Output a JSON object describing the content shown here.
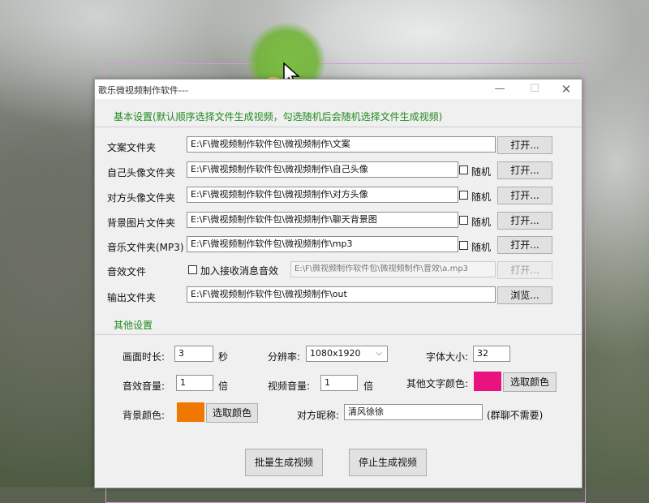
{
  "window": {
    "title": "歌乐微视频制作软件---",
    "minimize": "—",
    "maximize": "☐",
    "close": "✕"
  },
  "basic": {
    "group_title": "基本设置(默认顺序选择文件生成视频，勾选随机后会随机选择文件生成视频)",
    "rows": [
      {
        "label": "文案文件夹",
        "path": "E:\\F\\微视频制作软件包\\微视频制作\\文案",
        "random": "",
        "button": "打开..."
      },
      {
        "label": "自己头像文件夹",
        "path": "E:\\F\\微视频制作软件包\\微视频制作\\自己头像",
        "random": "随机",
        "button": "打开..."
      },
      {
        "label": "对方头像文件夹",
        "path": "E:\\F\\微视频制作软件包\\微视频制作\\对方头像",
        "random": "随机",
        "button": "打开..."
      },
      {
        "label": "背景图片文件夹",
        "path": "E:\\F\\微视频制作软件包\\微视频制作\\聊天背景图",
        "random": "随机",
        "button": "打开..."
      },
      {
        "label": "音乐文件夹(MP3)",
        "path": "E:\\F\\微视频制作软件包\\微视频制作\\mp3",
        "random": "随机",
        "button": "打开..."
      }
    ],
    "sound": {
      "label": "音效文件",
      "checkbox_label": "加入接收消息音效",
      "path": "E:\\F\\微视频制作软件包\\微视频制作\\音效\\a.mp3",
      "button": "打开..."
    },
    "output": {
      "label": "输出文件夹",
      "path": "E:\\F\\微视频制作软件包\\微视频制作\\out",
      "button": "浏览..."
    }
  },
  "other": {
    "group_title": "其他设置",
    "duration_label": "画面时长:",
    "duration_value": "3",
    "duration_unit": "秒",
    "resolution_label": "分辨率:",
    "resolution_value": "1080x1920",
    "resolution_arrow": "⌵",
    "font_size_label": "字体大小:",
    "font_size_value": "32",
    "sfx_volume_label": "音效音量:",
    "sfx_volume_value": "1",
    "sfx_volume_unit": "倍",
    "video_volume_label": "视频音量:",
    "video_volume_value": "1",
    "video_volume_unit": "倍",
    "text_color_label": "其他文字颜色:",
    "text_color": "#e8137e",
    "text_color_button": "选取颜色",
    "bg_color_label": "背景颜色:",
    "bg_color": "#f07800",
    "bg_color_button": "选取颜色",
    "nickname_label": "对方昵称:",
    "nickname_value": "清风徐徐",
    "nickname_note": "(群聊不需要)"
  },
  "actions": {
    "batch_generate": "批量生成视频",
    "stop_generate": "停止生成视频"
  }
}
